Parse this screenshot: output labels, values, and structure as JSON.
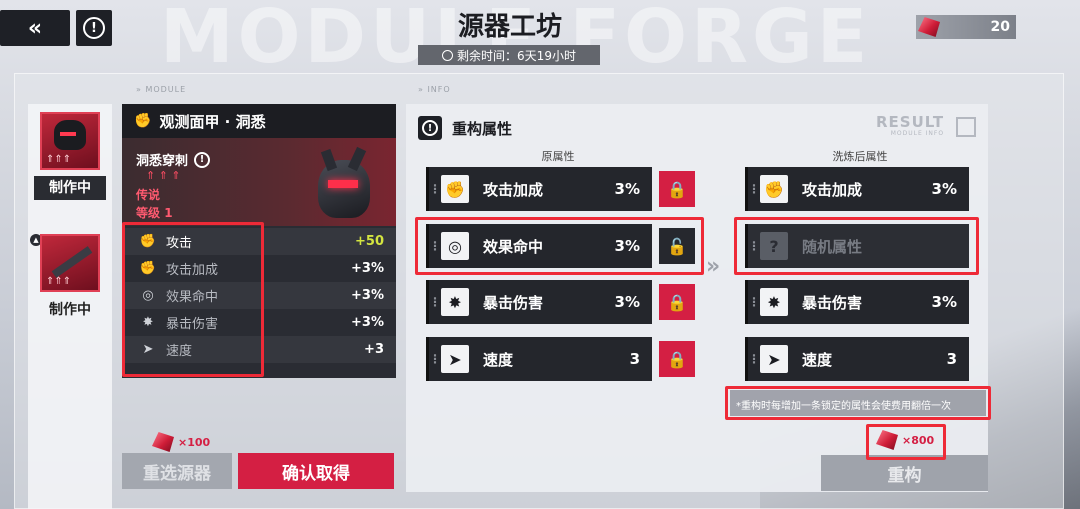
{
  "header": {
    "title": "源器工坊",
    "timer_text": "剩余时间：6天19小时",
    "watermark": "MODULE FORGE",
    "currency_amount": "20"
  },
  "labels": {
    "module_section": "MODULE",
    "info_section": "INFO",
    "result": "RESULT",
    "result_sub": "MODULE INFO"
  },
  "slots": [
    {
      "label": "制作中"
    },
    {
      "label": "制作中"
    }
  ],
  "module": {
    "name": "观测面甲 · 洞悉",
    "skill": "洞悉穿刺",
    "rarity": "传说",
    "level_label": "等级",
    "level": "1",
    "stats": [
      {
        "icon": "fist-icon",
        "name": "攻击",
        "value": "+50"
      },
      {
        "icon": "fist-icon",
        "name": "攻击加成",
        "value": "+3%"
      },
      {
        "icon": "target-icon",
        "name": "效果命中",
        "value": "+3%"
      },
      {
        "icon": "burst-icon",
        "name": "暴击伤害",
        "value": "+3%"
      },
      {
        "icon": "boot-icon",
        "name": "速度",
        "value": "+3"
      }
    ]
  },
  "reforge": {
    "panel_title": "重构属性",
    "original_header": "原属性",
    "result_header": "洗炼后属性",
    "original": [
      {
        "name": "攻击加成",
        "value": "3%"
      },
      {
        "name": "效果命中",
        "value": "3%"
      },
      {
        "name": "暴击伤害",
        "value": "3%"
      },
      {
        "name": "速度",
        "value": "3"
      }
    ],
    "result": [
      {
        "name": "攻击加成",
        "value": "3%"
      },
      {
        "name": "随机属性",
        "value": ""
      },
      {
        "name": "暴击伤害",
        "value": "3%"
      },
      {
        "name": "速度",
        "value": "3"
      }
    ],
    "note": "*重构时每增加一条锁定的属性会使费用翻倍一次",
    "cost": "×800",
    "button": "重构"
  },
  "actions": {
    "reselect_cost": "×100",
    "reselect_button": "重选源器",
    "confirm_button": "确认取得"
  },
  "colors": {
    "accent_red": "#d41f43",
    "highlight_green": "#d4e540",
    "annotation_red": "#ee2a37"
  }
}
